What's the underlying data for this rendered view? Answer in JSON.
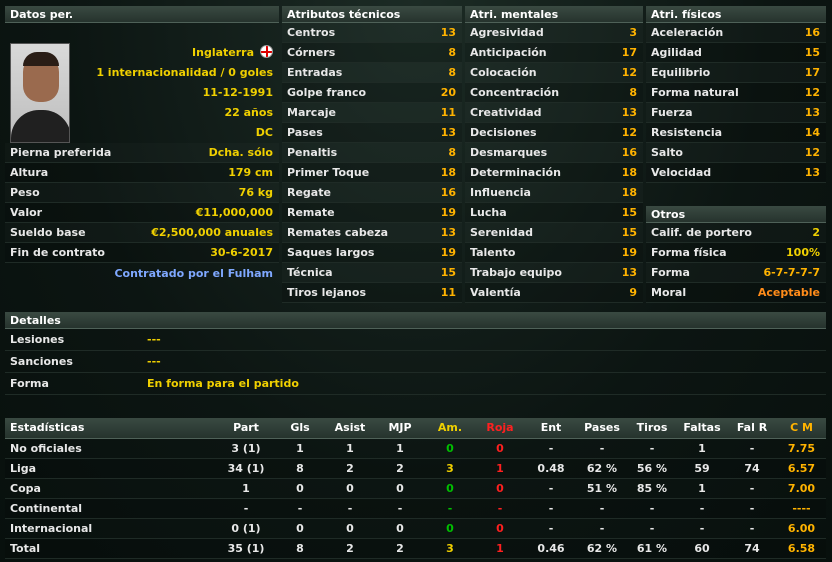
{
  "personal": {
    "title": "Datos per.",
    "nationality": "Inglaterra",
    "caps": "1 internacionalidad / 0 goles",
    "birthdate": "11-12-1991",
    "age": "22 años",
    "position": "DC",
    "rows": [
      {
        "label": "Pierna preferida",
        "value": "Dcha. sólo"
      },
      {
        "label": "Altura",
        "value": "179 cm"
      },
      {
        "label": "Peso",
        "value": "76 kg"
      },
      {
        "label": "Valor",
        "value": "€11,000,000"
      },
      {
        "label": "Sueldo base",
        "value": "€2,500,000 anuales"
      },
      {
        "label": "Fin de contrato",
        "value": "30-6-2017"
      }
    ],
    "contracted_by": "Contratado por el Fulham"
  },
  "technical": {
    "title": "Atributos técnicos",
    "rows": [
      {
        "label": "Centros",
        "value": "13"
      },
      {
        "label": "Córners",
        "value": "8"
      },
      {
        "label": "Entradas",
        "value": "8"
      },
      {
        "label": "Golpe franco",
        "value": "20"
      },
      {
        "label": "Marcaje",
        "value": "11"
      },
      {
        "label": "Pases",
        "value": "13"
      },
      {
        "label": "Penaltis",
        "value": "8"
      },
      {
        "label": "Primer Toque",
        "value": "18"
      },
      {
        "label": "Regate",
        "value": "16"
      },
      {
        "label": "Remate",
        "value": "19"
      },
      {
        "label": "Remates cabeza",
        "value": "13"
      },
      {
        "label": "Saques largos",
        "value": "19"
      },
      {
        "label": "Técnica",
        "value": "15"
      },
      {
        "label": "Tiros lejanos",
        "value": "11"
      }
    ]
  },
  "mental": {
    "title": "Atri. mentales",
    "rows": [
      {
        "label": "Agresividad",
        "value": "3"
      },
      {
        "label": "Anticipación",
        "value": "17"
      },
      {
        "label": "Colocación",
        "value": "12"
      },
      {
        "label": "Concentración",
        "value": "8"
      },
      {
        "label": "Creatividad",
        "value": "13"
      },
      {
        "label": "Decisiones",
        "value": "12"
      },
      {
        "label": "Desmarques",
        "value": "16"
      },
      {
        "label": "Determinación",
        "value": "18"
      },
      {
        "label": "Influencia",
        "value": "18"
      },
      {
        "label": "Lucha",
        "value": "15"
      },
      {
        "label": "Serenidad",
        "value": "15"
      },
      {
        "label": "Talento",
        "value": "19"
      },
      {
        "label": "Trabajo equipo",
        "value": "13"
      },
      {
        "label": "Valentía",
        "value": "9"
      }
    ]
  },
  "physical": {
    "title": "Atri. físicos",
    "rows": [
      {
        "label": "Aceleración",
        "value": "16"
      },
      {
        "label": "Agilidad",
        "value": "15"
      },
      {
        "label": "Equilibrio",
        "value": "17"
      },
      {
        "label": "Forma natural",
        "value": "12"
      },
      {
        "label": "Fuerza",
        "value": "13"
      },
      {
        "label": "Resistencia",
        "value": "14"
      },
      {
        "label": "Salto",
        "value": "12"
      },
      {
        "label": "Velocidad",
        "value": "13"
      }
    ]
  },
  "others": {
    "title": "Otros",
    "rows": [
      {
        "label": "Calif. de portero",
        "value": "2"
      },
      {
        "label": "Forma física",
        "value": "100%"
      },
      {
        "label": "Forma",
        "value": "6-7-7-7-7"
      },
      {
        "label": "Moral",
        "value": "Aceptable"
      }
    ]
  },
  "details": {
    "title": "Detalles",
    "rows": [
      {
        "label": "Lesiones",
        "value": "---"
      },
      {
        "label": "Sanciones",
        "value": "---"
      },
      {
        "label": "Forma",
        "value": "En forma para el partido"
      }
    ]
  },
  "stats": {
    "headers": [
      "Estadísticas",
      "Part",
      "Gls",
      "Asist",
      "MJP",
      "Am.",
      "Roja",
      "Ent",
      "Pases",
      "Tiros",
      "Faltas",
      "Fal R",
      "C M"
    ],
    "rows": [
      [
        "No oficiales",
        "3 (1)",
        "1",
        "1",
        "1",
        "0",
        "0",
        "-",
        "-",
        "-",
        "1",
        "-",
        "7.75"
      ],
      [
        "Liga",
        "34 (1)",
        "8",
        "2",
        "2",
        "3",
        "1",
        "0.48",
        "62 %",
        "56 %",
        "59",
        "74",
        "6.57"
      ],
      [
        "Copa",
        "1",
        "0",
        "0",
        "0",
        "0",
        "0",
        "-",
        "51 %",
        "85 %",
        "1",
        "-",
        "7.00"
      ],
      [
        "Continental",
        "-",
        "-",
        "-",
        "-",
        "-",
        "-",
        "-",
        "-",
        "-",
        "-",
        "-",
        "----"
      ],
      [
        "Internacional",
        "0 (1)",
        "0",
        "0",
        "0",
        "0",
        "0",
        "-",
        "-",
        "-",
        "-",
        "-",
        "6.00"
      ],
      [
        "Total",
        "35 (1)",
        "8",
        "2",
        "2",
        "3",
        "1",
        "0.46",
        "62 %",
        "61 %",
        "60",
        "74",
        "6.58"
      ]
    ]
  },
  "colors": {
    "value": "#ffb300",
    "yellow": "#f0d000",
    "green": "#00c000",
    "red": "#ff2020",
    "link": "#7fa8ff"
  }
}
